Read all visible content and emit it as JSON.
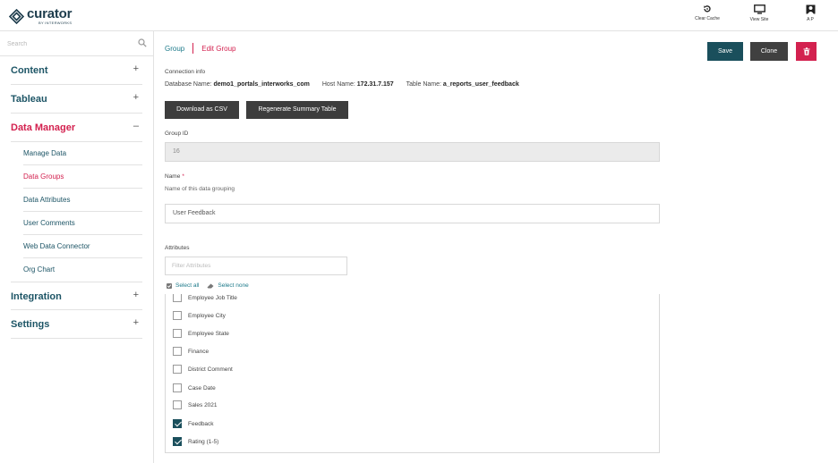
{
  "app": {
    "logo_name": "curator",
    "logo_sub": "BY INTERWORKS"
  },
  "top_actions": [
    {
      "label": "Clear Cache",
      "icon": "refresh-icon"
    },
    {
      "label": "View Site",
      "icon": "monitor-icon"
    },
    {
      "label": "A P",
      "icon": "user-icon"
    }
  ],
  "sidebar": {
    "search_placeholder": "Search",
    "items": [
      {
        "label": "Content",
        "toggle": "+"
      },
      {
        "label": "Tableau",
        "toggle": "+"
      },
      {
        "label": "Data Manager",
        "toggle": "–",
        "active": true
      },
      {
        "label": "Integration",
        "toggle": "+"
      },
      {
        "label": "Settings",
        "toggle": "+"
      }
    ],
    "sub_items": [
      {
        "label": "Manage Data"
      },
      {
        "label": "Data Groups",
        "active": true
      },
      {
        "label": "Data Attributes"
      },
      {
        "label": "User Comments"
      },
      {
        "label": "Web Data Connector"
      },
      {
        "label": "Org Chart"
      }
    ]
  },
  "breadcrumb": {
    "parent": "Group",
    "current": "Edit Group"
  },
  "toolbar": {
    "save_label": "Save",
    "clone_label": "Clone"
  },
  "connection": {
    "heading": "Connection info",
    "db_label": "Database Name:",
    "db_value": "demo1_portals_interworks_com",
    "host_label": "Host Name:",
    "host_value": "172.31.7.157",
    "table_label": "Table Name:",
    "table_value": "a_reports_user_feedback"
  },
  "buttons": {
    "download_csv": "Download as CSV",
    "regenerate": "Regenerate Summary Table"
  },
  "group_id": {
    "label": "Group ID",
    "value": "16"
  },
  "name_field": {
    "label": "Name",
    "required_mark": "*",
    "help": "Name of this data grouping",
    "value": "User Feedback"
  },
  "attributes": {
    "label": "Attributes",
    "filter_placeholder": "Filter Attributes",
    "select_all": "Select all",
    "select_none": "Select none",
    "items": [
      {
        "label": "Employee Job Title",
        "checked": false
      },
      {
        "label": "Employee City",
        "checked": false
      },
      {
        "label": "Employee State",
        "checked": false
      },
      {
        "label": "Finance",
        "checked": false
      },
      {
        "label": "District Comment",
        "checked": false
      },
      {
        "label": "Case Date",
        "checked": false
      },
      {
        "label": "Sales 2021",
        "checked": false
      },
      {
        "label": "Feedback",
        "checked": true
      },
      {
        "label": "Rating (1-5)",
        "checked": true
      }
    ]
  },
  "colors": {
    "accent": "#d3214f",
    "primary": "#1a4f5c",
    "nav_text": "#1d5566"
  }
}
